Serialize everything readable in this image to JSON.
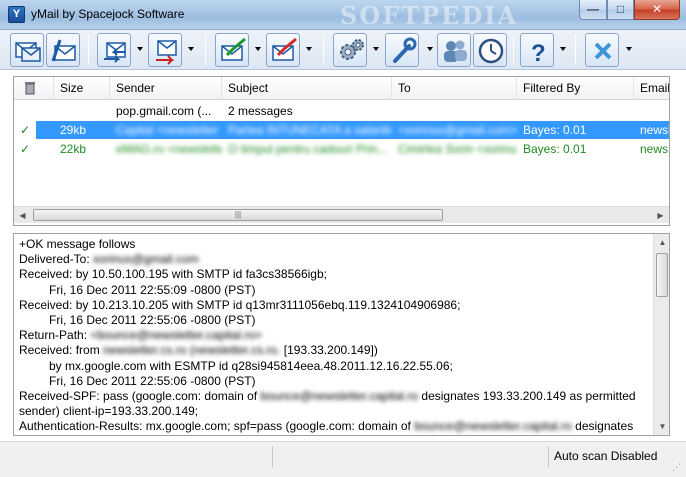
{
  "window": {
    "title": "yMail by Spacejock Software",
    "watermark": "SOFTPEDIA",
    "minimize": "—",
    "maximize": "□",
    "close": "✕"
  },
  "toolbar": {
    "buttons": [
      {
        "name": "check-mail-button",
        "icon": "envelopes-icon"
      },
      {
        "name": "compose-button",
        "icon": "envelope-pen-icon"
      },
      {
        "name": "send-receive-button",
        "icon": "mail-arrows-icon"
      },
      {
        "name": "forward-button",
        "icon": "mail-forward-icon"
      },
      {
        "name": "mark-good-button",
        "icon": "mail-green-check-icon"
      },
      {
        "name": "mark-spam-button",
        "icon": "mail-red-mark-icon"
      },
      {
        "name": "settings-button",
        "icon": "gears-icon"
      },
      {
        "name": "tools-button",
        "icon": "wrench-icon"
      },
      {
        "name": "contacts-button",
        "icon": "people-icon"
      },
      {
        "name": "schedule-button",
        "icon": "clock-icon"
      },
      {
        "name": "help-button",
        "icon": "question-icon"
      },
      {
        "name": "delete-button",
        "icon": "x-icon"
      }
    ]
  },
  "list": {
    "columns": [
      "",
      "Size",
      "Sender",
      "Subject",
      "To",
      "Filtered By",
      "Email"
    ],
    "rows": [
      {
        "status": "",
        "size": "",
        "sender": "pop.gmail.com (...",
        "subject": "2 messages",
        "to": "",
        "filtered": "",
        "email": ""
      },
      {
        "status": "✓",
        "size": "29kb",
        "sender": "Capital <newsletter",
        "subject": "Partea INTUNECATA a salariilor...",
        "to": "<xorinus@gmail.com>",
        "filtered": "Bayes: 0.01",
        "email": "newsl"
      },
      {
        "status": "✓",
        "size": "22kb",
        "sender": "eMAG.ro <newsletter@...",
        "subject": "O timpul pentru cadouri Prin...",
        "to": "Cimirlea Sorin <xorinus@...",
        "filtered": "Bayes: 0.01",
        "email": "news@"
      }
    ]
  },
  "body": {
    "lines": [
      {
        "text": "+OK message follows",
        "indent": 0
      },
      {
        "text": "Delivered-To: ",
        "blur": "xorinus@gmail.com",
        "indent": 0
      },
      {
        "text": "Received: by 10.50.100.195 with SMTP id fa3cs38566igb;",
        "indent": 0
      },
      {
        "text": "Fri, 16 Dec 2011 22:55:09 -0800 (PST)",
        "indent": 1
      },
      {
        "text": "Received: by 10.213.10.205 with SMTP id q13mr3111056ebq.119.1324104906986;",
        "indent": 0
      },
      {
        "text": "Fri, 16 Dec 2011 22:55:06 -0800 (PST)",
        "indent": 1
      },
      {
        "text": "Return-Path: ",
        "blur": "<bounce@newsletter.capital.ro>",
        "indent": 0
      },
      {
        "text": "Received: from ",
        "blur": "newsletter.cs.ro (newsletter.cs.ro.",
        "after": " [193.33.200.149])",
        "indent": 0
      },
      {
        "text": "by mx.google.com with ESMTP id q28si945814eea.48.2011.12.16.22.55.06;",
        "indent": 1
      },
      {
        "text": "Fri, 16 Dec 2011 22:55:06 -0800 (PST)",
        "indent": 1
      },
      {
        "text": "Received-SPF: pass (google.com: domain of ",
        "blur": "bounce@newsletter.capital.ro",
        "after": " designates 193.33.200.149 as permitted",
        "indent": 0
      },
      {
        "text": "sender) client-ip=193.33.200.149;",
        "indent": 0
      },
      {
        "text": "Authentication-Results: mx.google.com; spf=pass (google.com: domain of ",
        "blur": "bounce@newsletter.capital.ro",
        "after": " designates",
        "indent": 0
      }
    ]
  },
  "status": {
    "scan": "Auto scan Disabled"
  }
}
